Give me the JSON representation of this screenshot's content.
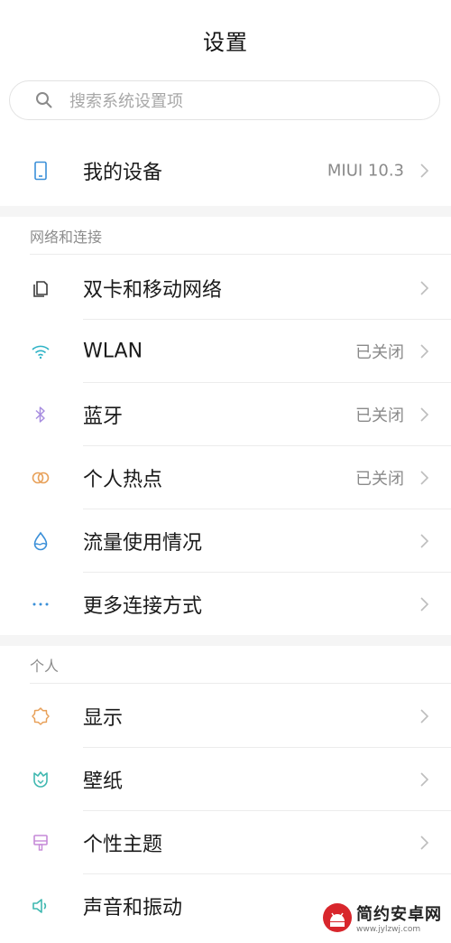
{
  "header": {
    "title": "设置"
  },
  "search": {
    "placeholder": "搜索系统设置项",
    "icon": "search-icon"
  },
  "device": {
    "label": "我的设备",
    "value": "MIUI 10.3",
    "icon": "phone-icon"
  },
  "sections": {
    "network": {
      "title": "网络和连接",
      "items": [
        {
          "label": "双卡和移动网络",
          "value": "",
          "icon": "sim-card-icon",
          "color": "#3b3b3b"
        },
        {
          "label": "WLAN",
          "value": "已关闭",
          "icon": "wifi-icon",
          "color": "#2fb3c6"
        },
        {
          "label": "蓝牙",
          "value": "已关闭",
          "icon": "bluetooth-icon",
          "color": "#a88ee0"
        },
        {
          "label": "个人热点",
          "value": "已关闭",
          "icon": "hotspot-icon",
          "color": "#e8a15a"
        },
        {
          "label": "流量使用情况",
          "value": "",
          "icon": "data-usage-icon",
          "color": "#3a8fd8"
        },
        {
          "label": "更多连接方式",
          "value": "",
          "icon": "more-icon",
          "color": "#3a8fd8"
        }
      ]
    },
    "personal": {
      "title": "个人",
      "items": [
        {
          "label": "显示",
          "value": "",
          "icon": "brightness-icon",
          "color": "#e8a15a"
        },
        {
          "label": "壁纸",
          "value": "",
          "icon": "wallpaper-icon",
          "color": "#3fb8b0"
        },
        {
          "label": "个性主题",
          "value": "",
          "icon": "theme-icon",
          "color": "#c68ad8"
        },
        {
          "label": "声音和振动",
          "value": "",
          "icon": "sound-icon",
          "color": "#3fb8b0"
        }
      ]
    }
  },
  "watermark": {
    "name": "简约安卓网",
    "url": "www.jylzwj.com"
  }
}
